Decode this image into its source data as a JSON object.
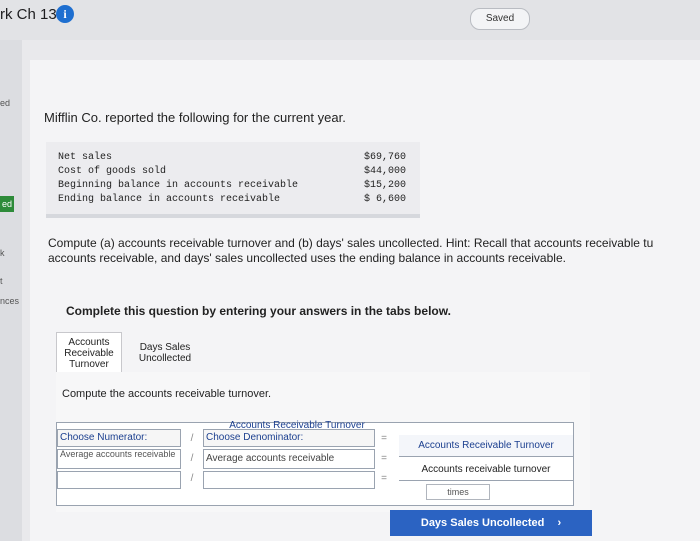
{
  "header": {
    "title": "rk Ch 13",
    "saved_label": "Saved"
  },
  "left_strip": {
    "labels": [
      "ed",
      "k",
      "t",
      "nces"
    ]
  },
  "question": {
    "intro": "Mifflin Co. reported the following for the current year.",
    "data": [
      {
        "label": "Net sales",
        "value": "$69,760"
      },
      {
        "label": "Cost of goods sold",
        "value": "$44,000"
      },
      {
        "label": "Beginning balance in accounts receivable",
        "value": "$15,200"
      },
      {
        "label": "Ending balance in accounts receivable",
        "value": "$ 6,600"
      }
    ],
    "instructions_line1": "Compute (a) accounts receivable turnover and (b) days' sales uncollected. Hint: Recall that accounts receivable tu",
    "instructions_line2": "accounts receivable, and days' sales uncollected uses the ending balance in accounts receivable.",
    "complete_label": "Complete this question by entering your answers in the tabs below."
  },
  "tabs": {
    "active_line1": "Accounts",
    "active_line2": "Receivable",
    "active_line3": "Turnover",
    "inactive_line1": "Days Sales",
    "inactive_line2": "Uncollected"
  },
  "panel": {
    "sub_instruction": "Compute the accounts receivable turnover.",
    "grid_title": "Accounts Receivable Turnover",
    "numerator_header": "Choose Numerator:",
    "denominator_header": "Choose Denominator:",
    "numerator_value": "Average accounts receivable",
    "denominator_value": "Average accounts receivable",
    "divide_symbol": "/",
    "equals_symbol": "=",
    "result_header": "Accounts Receivable Turnover",
    "result_value": "Accounts receivable turnover",
    "times_label": "times"
  },
  "next_button": {
    "label": "Days Sales Uncollected",
    "chevron": "›"
  },
  "colors": {
    "accent": "#2b63c2",
    "info_icon": "#1e6fd0",
    "link_text": "#1b3f8f",
    "left_tab": "#2e8b3a"
  }
}
